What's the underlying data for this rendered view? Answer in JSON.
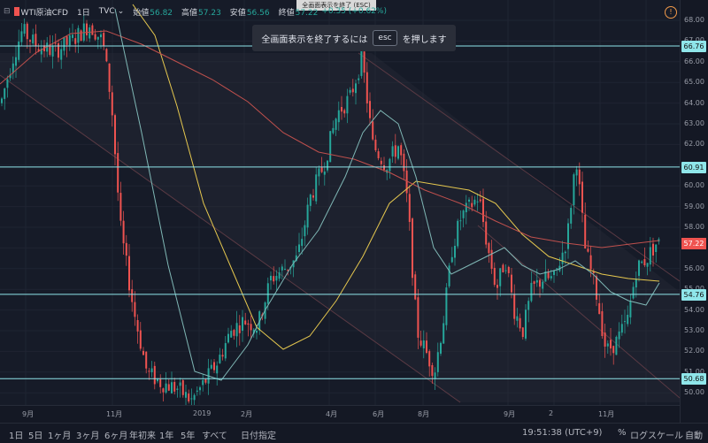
{
  "legend": {
    "symbol": "WTI原油CFD",
    "interval": "1日",
    "source": "TVC",
    "open_label": "始値",
    "open": "56.82",
    "high_label": "高値",
    "high": "57.23",
    "low_label": "安値",
    "low": "56.56",
    "close_label": "終値",
    "close": "57.22",
    "change": "+0.35 (+0.62%)"
  },
  "banner": {
    "text_before": "全画面表示を終了するには",
    "key": "esc",
    "text_after": "を押します"
  },
  "tooltip": "全画面表示を終了 (ESC)",
  "alert_icon": "clock-alert-icon",
  "price_axis": {
    "ticks": [
      "68.00",
      "67.00",
      "66.00",
      "65.00",
      "64.00",
      "63.00",
      "62.00",
      "61.00",
      "60.00",
      "59.00",
      "58.00",
      "57.00",
      "56.00",
      "55.00",
      "54.00",
      "53.00",
      "52.00",
      "51.00",
      "50.00"
    ],
    "hlines": [
      {
        "label": "66.76",
        "value": 66.76
      },
      {
        "label": "60.91",
        "value": 60.91
      },
      {
        "label": "54.76",
        "value": 54.76
      },
      {
        "label": "50.68",
        "value": 50.68
      }
    ],
    "current": {
      "label": "57.22",
      "value": 57.22
    }
  },
  "time_axis": [
    "9月",
    "11月",
    "2019",
    "2月",
    "4月",
    "6月",
    "8月",
    "9月",
    "2",
    "11月"
  ],
  "toolbar": {
    "ranges": [
      "1日",
      "5日",
      "1ヶ月",
      "3ヶ月",
      "6ヶ月",
      "年初来",
      "1年",
      "5年",
      "すべて"
    ],
    "date_range": "日付指定",
    "time": "19:51:38 (UTC+9)",
    "percent": "%",
    "log_scale": "ログスケール",
    "auto": "自動"
  },
  "colors": {
    "up": "#26a69a",
    "down": "#ef5350",
    "hline": "#8fe6ea",
    "ma_yellow": "#e6c84f",
    "ma_red": "#c0504d",
    "ma_teal": "#7fb7b5"
  }
}
